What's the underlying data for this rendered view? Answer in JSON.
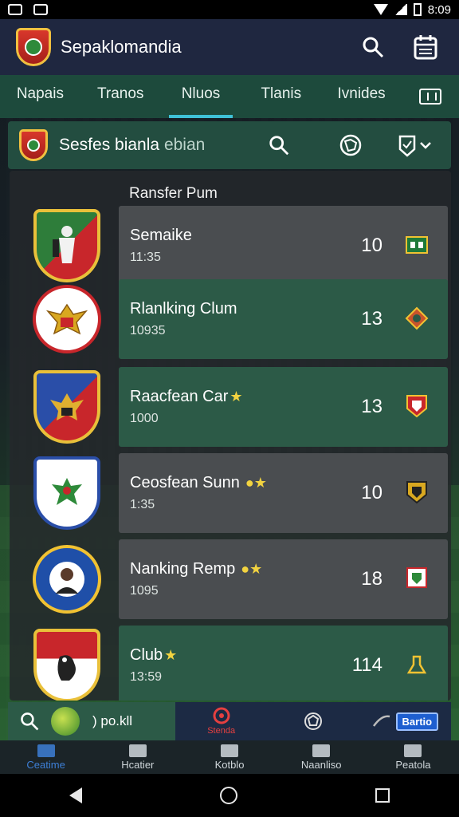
{
  "status_bar": {
    "time": "8:09"
  },
  "app_bar": {
    "title": "Sepaklomandia"
  },
  "tabs": [
    {
      "label": "Napais",
      "active": false
    },
    {
      "label": "Tranos",
      "active": false
    },
    {
      "label": "Nluos",
      "active": true
    },
    {
      "label": "Tlanis",
      "active": false
    },
    {
      "label": "Ivnides",
      "active": false
    }
  ],
  "subheader": {
    "title": "Sesfes bianla",
    "title_suffix": "ebian"
  },
  "panel": {
    "header": "Ransfer Pum"
  },
  "rows": [
    {
      "name": "Semaike",
      "star": false,
      "sub": "11:35",
      "number": "10",
      "card": "gray"
    },
    {
      "name": "Rlanlking Clum",
      "star": false,
      "sub": "10935",
      "number": "13",
      "card": "green"
    },
    {
      "name": "Raacfean Car",
      "star": true,
      "sub": "1000",
      "number": "13",
      "card": "green"
    },
    {
      "name": "Ceosfean Sunn",
      "star": true,
      "sub": "1:35",
      "number": "10",
      "card": "gray"
    },
    {
      "name": "Nanking Remp",
      "star": true,
      "sub": "1095",
      "number": "18",
      "card": "gray"
    },
    {
      "name": "Club",
      "star": true,
      "sub": "13:59",
      "number": "114",
      "card": "green"
    }
  ],
  "bottom_bar": {
    "search_text": ") po.kll",
    "center_label": "Stenda",
    "brand_label": "Bartio"
  },
  "nav": [
    {
      "label": "Ceatime",
      "active": true
    },
    {
      "label": "Hcatier",
      "active": false
    },
    {
      "label": "Kotblo",
      "active": false
    },
    {
      "label": "Naanliso",
      "active": false
    },
    {
      "label": "Peatola",
      "active": false
    }
  ],
  "colors": {
    "appbar": "#1f2740",
    "tabs": "#1d4a3c",
    "accent": "#3fc1d7",
    "card_green": "#2c5a47",
    "card_gray": "#4a4d50"
  }
}
